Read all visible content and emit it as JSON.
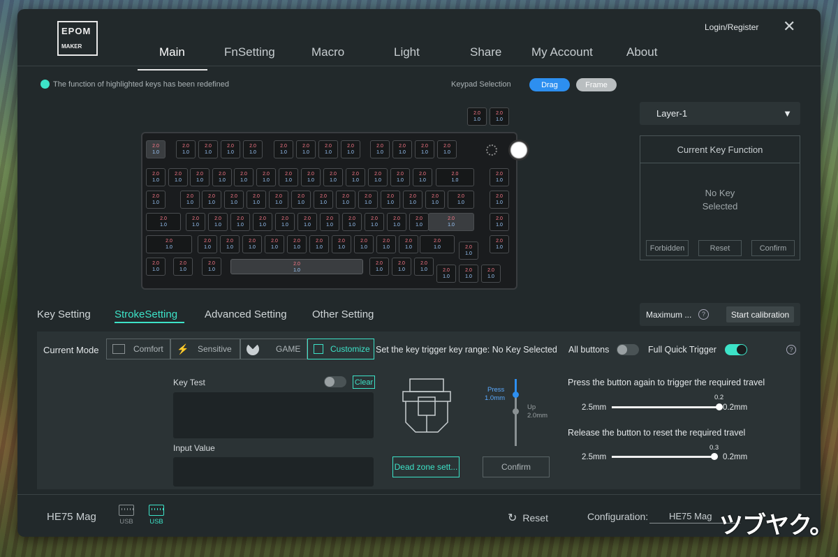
{
  "app": {
    "logo_top": "EPOM",
    "logo_bottom": "MAKER"
  },
  "nav": {
    "items": [
      "Main",
      "FnSetting",
      "Macro",
      "Light",
      "Share",
      "My Account",
      "About"
    ],
    "active": "Main"
  },
  "header": {
    "login": "Login/Register"
  },
  "notice": "The function of highlighted keys has been redefined",
  "keypad": {
    "label": "Keypad Selection",
    "drag": "Drag",
    "frame": "Frame"
  },
  "key_caption": {
    "top": "2.0",
    "bottom": "1.0"
  },
  "layer": {
    "value": "Layer-1"
  },
  "fn_panel": {
    "title": "Current Key Function",
    "empty_line1": "No Key",
    "empty_line2": "Selected",
    "forbidden": "Forbidden",
    "reset": "Reset",
    "confirm": "Confirm"
  },
  "tabs": [
    "Key Setting",
    "StrokeSetting",
    "Advanced Setting",
    "Other Setting"
  ],
  "calibration": {
    "label": "Maximum ...",
    "button": "Start calibration"
  },
  "stroke": {
    "current_mode_label": "Current Mode",
    "modes": [
      "Comfort",
      "Sensitive",
      "GAME",
      "Customize"
    ],
    "selected_mode": "Customize",
    "range_text": "Set the key trigger key range: No Key Selected",
    "all_buttons": "All buttons",
    "all_buttons_on": false,
    "full_quick_trigger": "Full Quick Trigger",
    "full_quick_trigger_on": true,
    "key_test": "Key Test",
    "clear": "Clear",
    "input_value": "Input Value",
    "dead_zone": "Dead zone sett...",
    "confirm": "Confirm",
    "press_label": "Press",
    "press_value": "1.0mm",
    "up_label": "Up",
    "up_value": "2.0mm",
    "press_again_text": "Press the button again to trigger the required travel",
    "press_min": "2.5mm",
    "press_max": "0.2mm",
    "press_current": "0.2",
    "release_text": "Release the button to reset the required travel",
    "release_min": "2.5mm",
    "release_max": "0.2mm",
    "release_current": "0.3"
  },
  "footer": {
    "device": "HE75 Mag",
    "usb1": "USB",
    "usb2": "USB",
    "reset": "Reset",
    "config_label": "Configuration:",
    "config_value": "HE75 Mag"
  },
  "watermark": "ツブヤク。",
  "colors": {
    "accent": "#3de3c8",
    "drag_blue": "#2d8ff0",
    "window_bg": "#22292b"
  }
}
